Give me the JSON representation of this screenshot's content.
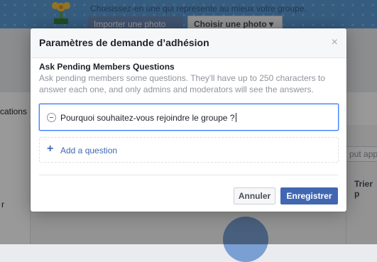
{
  "background": {
    "cover_hint": "Choisissez-en une qui représente au mieux votre groupe.",
    "import_photo_label": "Importer une photo",
    "choose_photo_label": "Choisir une photo",
    "tab_fragment": "cations",
    "search_fragment": "put appr",
    "sort_label": "Trier p",
    "row_fragment": "r"
  },
  "dialog": {
    "title": "Paramètres de demande d’adhésion",
    "close_label": "×",
    "section_title": "Ask Pending Members Questions",
    "section_description": "Ask pending members some questions. They'll have up to 250 characters to answer each one, and only admins and moderators will see the answers.",
    "questions": [
      {
        "text": "Pourquoi souhaitez-vous rejoindre le groupe ?"
      }
    ],
    "add_question_label": "Add a question",
    "cancel_label": "Annuler",
    "save_label": "Enregistrer"
  },
  "colors": {
    "primary": "#4267b2",
    "focus_border": "#4080ff",
    "muted_text": "#90949c"
  }
}
